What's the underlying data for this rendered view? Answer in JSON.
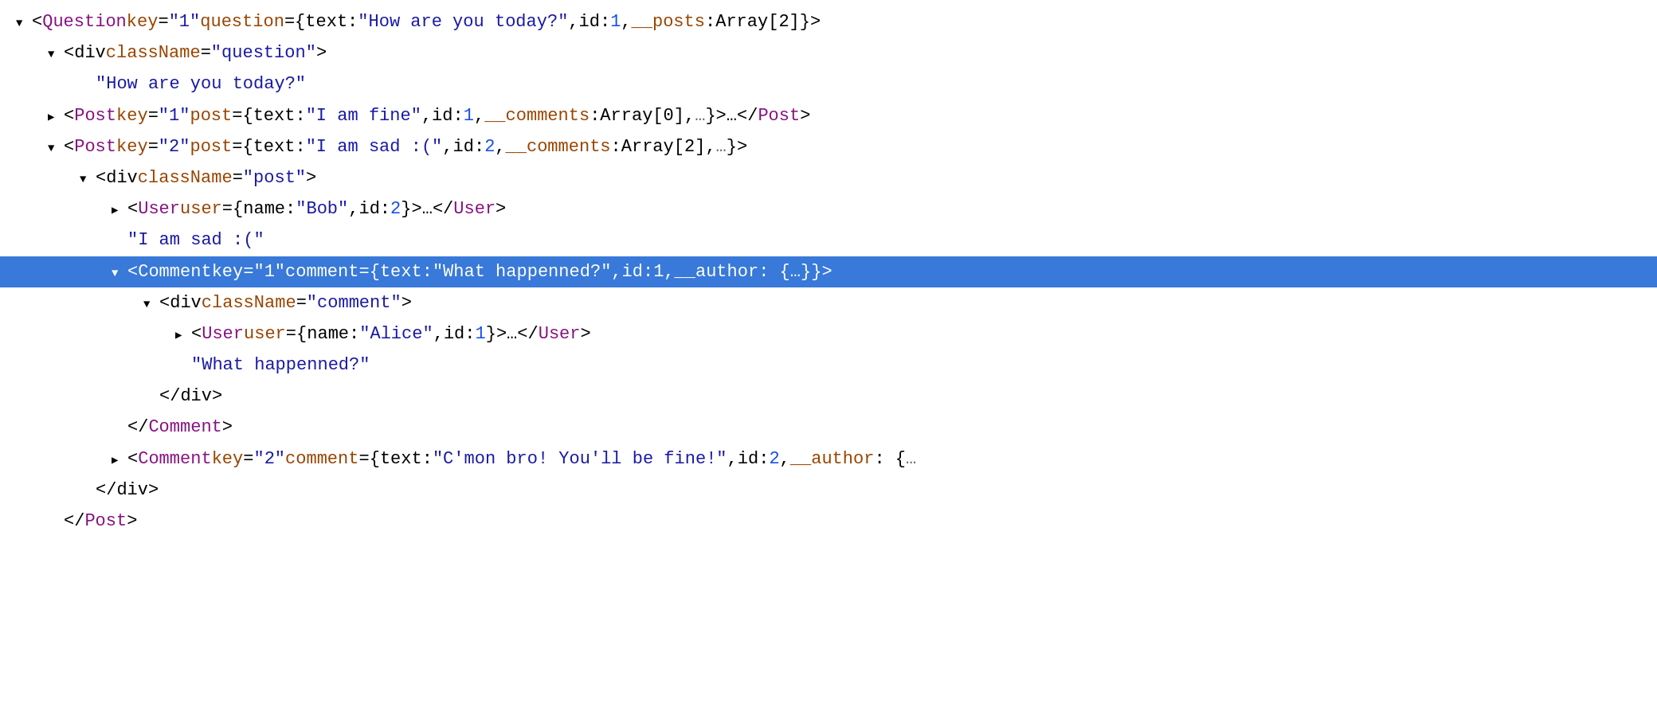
{
  "colors": {
    "selected_bg": "#3879d9",
    "tag": "#881280",
    "attr_name": "#994500",
    "string": "#1a1aa6",
    "number": "#1750eb",
    "punct": "#000000"
  },
  "lines": [
    {
      "id": "line-1",
      "indent": "indent-0",
      "toggle": "open",
      "selected": false,
      "parts": [
        {
          "type": "punct",
          "text": "<"
        },
        {
          "type": "tag",
          "text": "Question"
        },
        {
          "type": "punct",
          "text": " "
        },
        {
          "type": "attr",
          "text": "key"
        },
        {
          "type": "punct",
          "text": "="
        },
        {
          "type": "string",
          "text": "\"1\""
        },
        {
          "type": "punct",
          "text": " "
        },
        {
          "type": "attr",
          "text": "question"
        },
        {
          "type": "punct",
          "text": "={"
        },
        {
          "type": "plain",
          "text": "text: "
        },
        {
          "type": "string",
          "text": "\"How are you today?\""
        },
        {
          "type": "punct",
          "text": ", "
        },
        {
          "type": "plain",
          "text": "id: "
        },
        {
          "type": "number",
          "text": "1"
        },
        {
          "type": "punct",
          "text": ", "
        },
        {
          "type": "attr",
          "text": "__posts"
        },
        {
          "type": "punct",
          "text": ": "
        },
        {
          "type": "plain",
          "text": "Array[2]"
        },
        {
          "type": "punct",
          "text": "}>"
        }
      ]
    },
    {
      "id": "line-2",
      "indent": "indent-1",
      "toggle": "open",
      "selected": false,
      "parts": [
        {
          "type": "punct",
          "text": "<"
        },
        {
          "type": "plain",
          "text": "div "
        },
        {
          "type": "attr",
          "text": "className"
        },
        {
          "type": "punct",
          "text": "="
        },
        {
          "type": "string",
          "text": "\"question\""
        },
        {
          "type": "punct",
          "text": ">"
        }
      ]
    },
    {
      "id": "line-3",
      "indent": "indent-2",
      "toggle": "leaf",
      "selected": false,
      "parts": [
        {
          "type": "string",
          "text": "\"How are you today?\""
        }
      ]
    },
    {
      "id": "line-4",
      "indent": "indent-1",
      "toggle": "closed",
      "selected": false,
      "parts": [
        {
          "type": "punct",
          "text": "<"
        },
        {
          "type": "tag",
          "text": "Post"
        },
        {
          "type": "punct",
          "text": " "
        },
        {
          "type": "attr",
          "text": "key"
        },
        {
          "type": "punct",
          "text": "="
        },
        {
          "type": "string",
          "text": "\"1\""
        },
        {
          "type": "punct",
          "text": " "
        },
        {
          "type": "attr",
          "text": "post"
        },
        {
          "type": "punct",
          "text": "={"
        },
        {
          "type": "plain",
          "text": "text: "
        },
        {
          "type": "string",
          "text": "\"I am fine\""
        },
        {
          "type": "punct",
          "text": ", "
        },
        {
          "type": "plain",
          "text": "id: "
        },
        {
          "type": "number",
          "text": "1"
        },
        {
          "type": "punct",
          "text": ", "
        },
        {
          "type": "attr",
          "text": "__comments"
        },
        {
          "type": "punct",
          "text": ": "
        },
        {
          "type": "plain",
          "text": "Array[0]"
        },
        {
          "type": "punct",
          "text": ", "
        },
        {
          "type": "gray",
          "text": "…"
        },
        {
          "type": "punct",
          "text": "}>…</"
        },
        {
          "type": "tag",
          "text": "Post"
        },
        {
          "type": "punct",
          "text": ">"
        }
      ]
    },
    {
      "id": "line-5",
      "indent": "indent-1",
      "toggle": "open",
      "selected": false,
      "parts": [
        {
          "type": "punct",
          "text": "<"
        },
        {
          "type": "tag",
          "text": "Post"
        },
        {
          "type": "punct",
          "text": " "
        },
        {
          "type": "attr",
          "text": "key"
        },
        {
          "type": "punct",
          "text": "="
        },
        {
          "type": "string",
          "text": "\"2\""
        },
        {
          "type": "punct",
          "text": " "
        },
        {
          "type": "attr",
          "text": "post"
        },
        {
          "type": "punct",
          "text": "={"
        },
        {
          "type": "plain",
          "text": "text: "
        },
        {
          "type": "string",
          "text": "\"I am sad :(\""
        },
        {
          "type": "punct",
          "text": ", "
        },
        {
          "type": "plain",
          "text": "id: "
        },
        {
          "type": "number",
          "text": "2"
        },
        {
          "type": "punct",
          "text": ", "
        },
        {
          "type": "attr",
          "text": "__comments"
        },
        {
          "type": "punct",
          "text": ": "
        },
        {
          "type": "plain",
          "text": "Array[2]"
        },
        {
          "type": "punct",
          "text": ", "
        },
        {
          "type": "gray",
          "text": "…"
        },
        {
          "type": "punct",
          "text": "}>"
        }
      ]
    },
    {
      "id": "line-6",
      "indent": "indent-2",
      "toggle": "open",
      "selected": false,
      "parts": [
        {
          "type": "punct",
          "text": "<"
        },
        {
          "type": "plain",
          "text": "div "
        },
        {
          "type": "attr",
          "text": "className"
        },
        {
          "type": "punct",
          "text": "="
        },
        {
          "type": "string",
          "text": "\"post\""
        },
        {
          "type": "punct",
          "text": ">"
        }
      ]
    },
    {
      "id": "line-7",
      "indent": "indent-3",
      "toggle": "closed",
      "selected": false,
      "parts": [
        {
          "type": "punct",
          "text": "<"
        },
        {
          "type": "tag",
          "text": "User"
        },
        {
          "type": "punct",
          "text": " "
        },
        {
          "type": "attr",
          "text": "user"
        },
        {
          "type": "punct",
          "text": "={"
        },
        {
          "type": "plain",
          "text": "name: "
        },
        {
          "type": "string",
          "text": "\"Bob\""
        },
        {
          "type": "punct",
          "text": ", "
        },
        {
          "type": "plain",
          "text": "id: "
        },
        {
          "type": "number",
          "text": "2"
        },
        {
          "type": "punct",
          "text": "}>…</"
        },
        {
          "type": "tag",
          "text": "User"
        },
        {
          "type": "punct",
          "text": ">"
        }
      ]
    },
    {
      "id": "line-8",
      "indent": "indent-3",
      "toggle": "leaf",
      "selected": false,
      "parts": [
        {
          "type": "string",
          "text": "\"I am sad :(\""
        }
      ]
    },
    {
      "id": "line-9",
      "indent": "indent-3",
      "toggle": "open",
      "selected": true,
      "parts": [
        {
          "type": "punct",
          "text": "<"
        },
        {
          "type": "tag",
          "text": "Comment"
        },
        {
          "type": "punct",
          "text": " "
        },
        {
          "type": "attr",
          "text": "key"
        },
        {
          "type": "punct",
          "text": "="
        },
        {
          "type": "string",
          "text": "\"1\""
        },
        {
          "type": "punct",
          "text": " "
        },
        {
          "type": "attr",
          "text": "comment"
        },
        {
          "type": "punct",
          "text": "={"
        },
        {
          "type": "plain",
          "text": "text: "
        },
        {
          "type": "string",
          "text": "\"What happenned?\""
        },
        {
          "type": "punct",
          "text": ", "
        },
        {
          "type": "plain",
          "text": "id: "
        },
        {
          "type": "number",
          "text": "1"
        },
        {
          "type": "punct",
          "text": ", "
        },
        {
          "type": "attr",
          "text": "__author"
        },
        {
          "type": "punct",
          "text": ": {"
        },
        {
          "type": "gray",
          "text": "…"
        },
        {
          "type": "punct",
          "text": "}}>"
        }
      ]
    },
    {
      "id": "line-10",
      "indent": "indent-4",
      "toggle": "open",
      "selected": false,
      "parts": [
        {
          "type": "punct",
          "text": "<"
        },
        {
          "type": "plain",
          "text": "div "
        },
        {
          "type": "attr",
          "text": "className"
        },
        {
          "type": "punct",
          "text": "="
        },
        {
          "type": "string",
          "text": "\"comment\""
        },
        {
          "type": "punct",
          "text": ">"
        }
      ]
    },
    {
      "id": "line-11",
      "indent": "indent-5",
      "toggle": "closed",
      "selected": false,
      "parts": [
        {
          "type": "punct",
          "text": "<"
        },
        {
          "type": "tag",
          "text": "User"
        },
        {
          "type": "punct",
          "text": " "
        },
        {
          "type": "attr",
          "text": "user"
        },
        {
          "type": "punct",
          "text": "={"
        },
        {
          "type": "plain",
          "text": "name: "
        },
        {
          "type": "string",
          "text": "\"Alice\""
        },
        {
          "type": "punct",
          "text": ", "
        },
        {
          "type": "plain",
          "text": "id: "
        },
        {
          "type": "number",
          "text": "1"
        },
        {
          "type": "punct",
          "text": "}>…</"
        },
        {
          "type": "tag",
          "text": "User"
        },
        {
          "type": "punct",
          "text": ">"
        }
      ]
    },
    {
      "id": "line-12",
      "indent": "indent-5",
      "toggle": "leaf",
      "selected": false,
      "parts": [
        {
          "type": "string",
          "text": "\"What happenned?\""
        }
      ]
    },
    {
      "id": "line-13",
      "indent": "indent-4",
      "toggle": "leaf",
      "selected": false,
      "parts": [
        {
          "type": "punct",
          "text": "</"
        },
        {
          "type": "plain",
          "text": "div"
        },
        {
          "type": "punct",
          "text": ">"
        }
      ]
    },
    {
      "id": "line-14",
      "indent": "indent-3",
      "toggle": "leaf",
      "selected": false,
      "parts": [
        {
          "type": "punct",
          "text": "</"
        },
        {
          "type": "tag",
          "text": "Comment"
        },
        {
          "type": "punct",
          "text": ">"
        }
      ]
    },
    {
      "id": "line-15",
      "indent": "indent-3",
      "toggle": "closed",
      "selected": false,
      "parts": [
        {
          "type": "punct",
          "text": "<"
        },
        {
          "type": "tag",
          "text": "Comment"
        },
        {
          "type": "punct",
          "text": " "
        },
        {
          "type": "attr",
          "text": "key"
        },
        {
          "type": "punct",
          "text": "="
        },
        {
          "type": "string",
          "text": "\"2\""
        },
        {
          "type": "punct",
          "text": " "
        },
        {
          "type": "attr",
          "text": "comment"
        },
        {
          "type": "punct",
          "text": "={"
        },
        {
          "type": "plain",
          "text": "text: "
        },
        {
          "type": "string",
          "text": "\"C'mon bro! You'll be fine!\""
        },
        {
          "type": "punct",
          "text": ", "
        },
        {
          "type": "plain",
          "text": "id: "
        },
        {
          "type": "number",
          "text": "2"
        },
        {
          "type": "punct",
          "text": ", "
        },
        {
          "type": "attr",
          "text": "__author"
        },
        {
          "type": "punct",
          "text": ": {"
        },
        {
          "type": "gray",
          "text": "…"
        }
      ]
    },
    {
      "id": "line-16",
      "indent": "indent-2",
      "toggle": "leaf",
      "selected": false,
      "parts": [
        {
          "type": "punct",
          "text": "</"
        },
        {
          "type": "plain",
          "text": "div"
        },
        {
          "type": "punct",
          "text": ">"
        }
      ]
    },
    {
      "id": "line-17",
      "indent": "indent-1",
      "toggle": "leaf",
      "selected": false,
      "parts": [
        {
          "type": "punct",
          "text": "</"
        },
        {
          "type": "tag",
          "text": "Post"
        },
        {
          "type": "punct",
          "text": ">"
        }
      ]
    }
  ]
}
